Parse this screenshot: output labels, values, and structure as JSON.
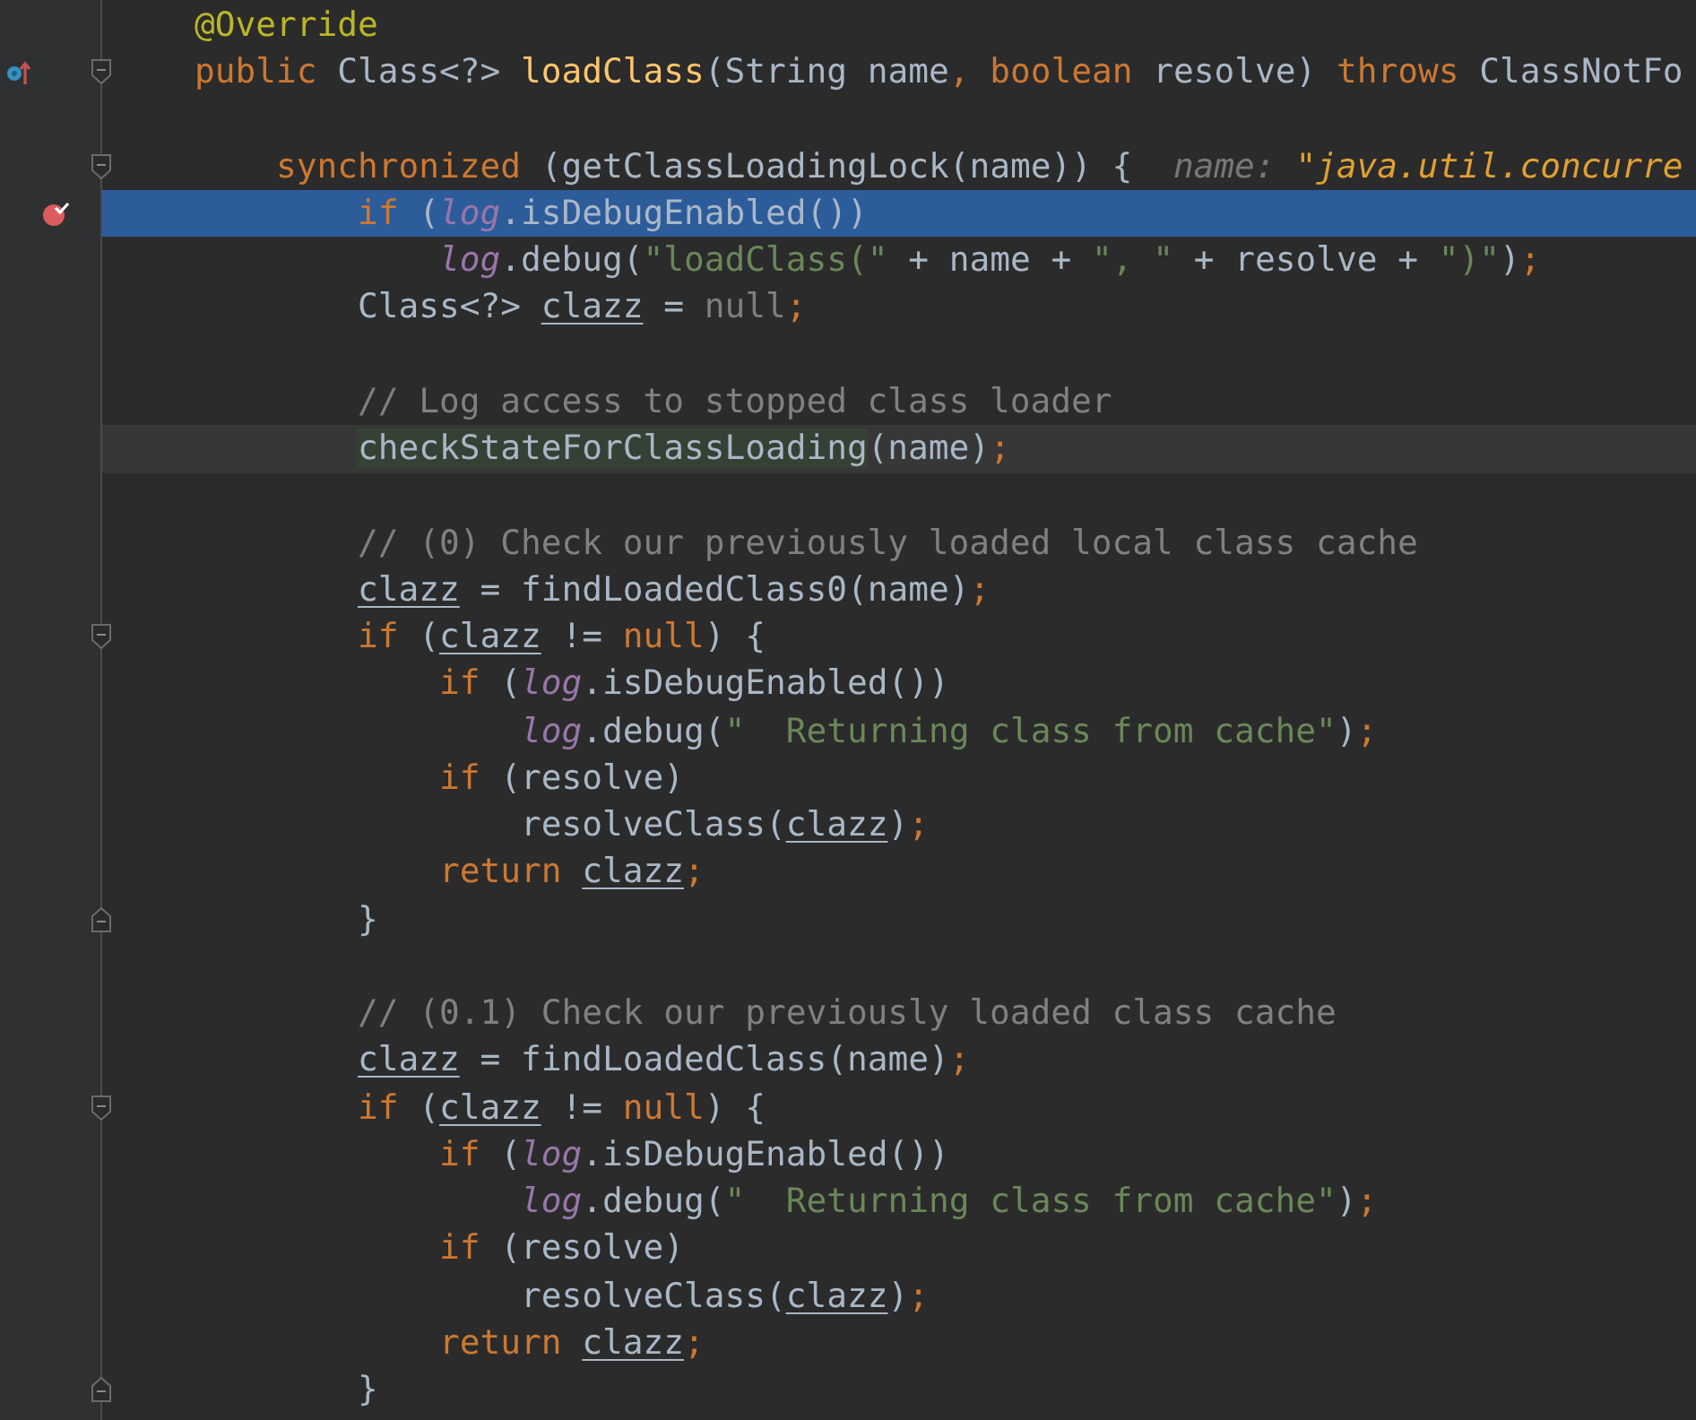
{
  "editor": {
    "lines": [
      {
        "execution_point": false,
        "caret_line": false,
        "breakpoint": false,
        "override_marker": false,
        "fold_start": false,
        "fold_end": false,
        "tokens": [
          {
            "kind": "annotation",
            "text": "    @Override"
          }
        ]
      },
      {
        "execution_point": false,
        "caret_line": false,
        "breakpoint": false,
        "override_marker": true,
        "fold_start": true,
        "fold_end": false,
        "tokens": [
          {
            "kind": "keyword",
            "text": "    public"
          },
          {
            "kind": "plain",
            "text": " Class<?> "
          },
          {
            "kind": "method",
            "text": "loadClass"
          },
          {
            "kind": "plain",
            "text": "(String name"
          },
          {
            "kind": "keyword",
            "text": ", boolean"
          },
          {
            "kind": "plain",
            "text": " resolve) "
          },
          {
            "kind": "keyword",
            "text": "throws"
          },
          {
            "kind": "plain",
            "text": " ClassNotFo"
          }
        ]
      },
      {
        "execution_point": false,
        "caret_line": false,
        "breakpoint": false,
        "override_marker": false,
        "fold_start": false,
        "fold_end": false
      },
      {
        "execution_point": false,
        "caret_line": false,
        "breakpoint": false,
        "override_marker": false,
        "fold_start": true,
        "fold_end": false,
        "tokens": [
          {
            "kind": "keyword",
            "text": "        synchronized"
          },
          {
            "kind": "plain",
            "text": " (getClassLoadingLock(name)) {  "
          },
          {
            "kind": "hint-label",
            "text": "name: "
          },
          {
            "kind": "hint-value",
            "text": "\"java.util.concurre"
          }
        ]
      },
      {
        "execution_point": true,
        "caret_line": false,
        "breakpoint": true,
        "override_marker": false,
        "fold_start": false,
        "fold_end": false,
        "tokens": [
          {
            "kind": "keyword",
            "text": "            if"
          },
          {
            "kind": "plain",
            "text": " ("
          },
          {
            "kind": "field",
            "text": "log"
          },
          {
            "kind": "plain",
            "text": ".isDebugEnabled())"
          }
        ]
      },
      {
        "execution_point": false,
        "caret_line": false,
        "breakpoint": false,
        "override_marker": false,
        "fold_start": false,
        "fold_end": false,
        "tokens": [
          {
            "kind": "field",
            "text": "                log"
          },
          {
            "kind": "plain",
            "text": ".debug("
          },
          {
            "kind": "string",
            "text": "\"loadClass(\""
          },
          {
            "kind": "plain",
            "text": " + name + "
          },
          {
            "kind": "string",
            "text": "\", \""
          },
          {
            "kind": "plain",
            "text": " + resolve + "
          },
          {
            "kind": "string",
            "text": "\")\""
          },
          {
            "kind": "plain",
            "text": ")"
          },
          {
            "kind": "keyword",
            "text": ";"
          }
        ]
      },
      {
        "execution_point": false,
        "caret_line": false,
        "breakpoint": false,
        "override_marker": false,
        "fold_start": false,
        "fold_end": false,
        "tokens": [
          {
            "kind": "plain",
            "text": "            Class<?> "
          },
          {
            "kind": "reassigned",
            "text": "clazz"
          },
          {
            "kind": "plain",
            "text": " = "
          },
          {
            "kind": "unused",
            "text": "null"
          },
          {
            "kind": "keyword",
            "text": ";"
          }
        ]
      },
      {
        "execution_point": false,
        "caret_line": false,
        "breakpoint": false,
        "override_marker": false,
        "fold_start": false,
        "fold_end": false
      },
      {
        "execution_point": false,
        "caret_line": false,
        "breakpoint": false,
        "override_marker": false,
        "fold_start": false,
        "fold_end": false,
        "tokens": [
          {
            "kind": "comment",
            "text": "            // Log access to stopped class loader"
          }
        ]
      },
      {
        "execution_point": false,
        "caret_line": true,
        "breakpoint": false,
        "override_marker": false,
        "fold_start": false,
        "fold_end": false,
        "tokens": [
          {
            "kind": "usage",
            "text": "            checkStateForClassLoading"
          },
          {
            "kind": "plain",
            "text": "(name)"
          },
          {
            "kind": "keyword",
            "text": ";"
          }
        ]
      },
      {
        "execution_point": false,
        "caret_line": false,
        "breakpoint": false,
        "override_marker": false,
        "fold_start": false,
        "fold_end": false
      },
      {
        "execution_point": false,
        "caret_line": false,
        "breakpoint": false,
        "override_marker": false,
        "fold_start": false,
        "fold_end": false,
        "tokens": [
          {
            "kind": "comment",
            "text": "            // (0) Check our previously loaded local class cache"
          }
        ]
      },
      {
        "execution_point": false,
        "caret_line": false,
        "breakpoint": false,
        "override_marker": false,
        "fold_start": false,
        "fold_end": false,
        "tokens": [
          {
            "kind": "reassigned",
            "text": "            clazz"
          },
          {
            "kind": "plain",
            "text": " = findLoadedClass0(name)"
          },
          {
            "kind": "keyword",
            "text": ";"
          }
        ]
      },
      {
        "execution_point": false,
        "caret_line": false,
        "breakpoint": false,
        "override_marker": false,
        "fold_start": true,
        "fold_end": false,
        "tokens": [
          {
            "kind": "keyword",
            "text": "            if"
          },
          {
            "kind": "plain",
            "text": " ("
          },
          {
            "kind": "reassigned",
            "text": "clazz"
          },
          {
            "kind": "plain",
            "text": " != "
          },
          {
            "kind": "keyword",
            "text": "null"
          },
          {
            "kind": "plain",
            "text": ") {"
          }
        ]
      },
      {
        "execution_point": false,
        "caret_line": false,
        "breakpoint": false,
        "override_marker": false,
        "fold_start": false,
        "fold_end": false,
        "tokens": [
          {
            "kind": "keyword",
            "text": "                if"
          },
          {
            "kind": "plain",
            "text": " ("
          },
          {
            "kind": "field",
            "text": "log"
          },
          {
            "kind": "plain",
            "text": ".isDebugEnabled())"
          }
        ]
      },
      {
        "execution_point": false,
        "caret_line": false,
        "breakpoint": false,
        "override_marker": false,
        "fold_start": false,
        "fold_end": false,
        "tokens": [
          {
            "kind": "field",
            "text": "                    log"
          },
          {
            "kind": "plain",
            "text": ".debug("
          },
          {
            "kind": "string",
            "text": "\"  Returning class from cache\""
          },
          {
            "kind": "plain",
            "text": ")"
          },
          {
            "kind": "keyword",
            "text": ";"
          }
        ]
      },
      {
        "execution_point": false,
        "caret_line": false,
        "breakpoint": false,
        "override_marker": false,
        "fold_start": false,
        "fold_end": false,
        "tokens": [
          {
            "kind": "keyword",
            "text": "                if"
          },
          {
            "kind": "plain",
            "text": " (resolve)"
          }
        ]
      },
      {
        "execution_point": false,
        "caret_line": false,
        "breakpoint": false,
        "override_marker": false,
        "fold_start": false,
        "fold_end": false,
        "tokens": [
          {
            "kind": "plain",
            "text": "                    resolveClass("
          },
          {
            "kind": "reassigned",
            "text": "clazz"
          },
          {
            "kind": "plain",
            "text": ")"
          },
          {
            "kind": "keyword",
            "text": ";"
          }
        ]
      },
      {
        "execution_point": false,
        "caret_line": false,
        "breakpoint": false,
        "override_marker": false,
        "fold_start": false,
        "fold_end": false,
        "tokens": [
          {
            "kind": "keyword",
            "text": "                return "
          },
          {
            "kind": "reassigned",
            "text": "clazz"
          },
          {
            "kind": "keyword",
            "text": ";"
          }
        ]
      },
      {
        "execution_point": false,
        "caret_line": false,
        "breakpoint": false,
        "override_marker": false,
        "fold_start": false,
        "fold_end": true,
        "tokens": [
          {
            "kind": "plain",
            "text": "            }"
          }
        ]
      },
      {
        "execution_point": false,
        "caret_line": false,
        "breakpoint": false,
        "override_marker": false,
        "fold_start": false,
        "fold_end": false
      },
      {
        "execution_point": false,
        "caret_line": false,
        "breakpoint": false,
        "override_marker": false,
        "fold_start": false,
        "fold_end": false,
        "tokens": [
          {
            "kind": "comment",
            "text": "            // (0.1) Check our previously loaded class cache"
          }
        ]
      },
      {
        "execution_point": false,
        "caret_line": false,
        "breakpoint": false,
        "override_marker": false,
        "fold_start": false,
        "fold_end": false,
        "tokens": [
          {
            "kind": "reassigned",
            "text": "            clazz"
          },
          {
            "kind": "plain",
            "text": " = findLoadedClass(name)"
          },
          {
            "kind": "keyword",
            "text": ";"
          }
        ]
      },
      {
        "execution_point": false,
        "caret_line": false,
        "breakpoint": false,
        "override_marker": false,
        "fold_start": true,
        "fold_end": false,
        "tokens": [
          {
            "kind": "keyword",
            "text": "            if"
          },
          {
            "kind": "plain",
            "text": " ("
          },
          {
            "kind": "reassigned",
            "text": "clazz"
          },
          {
            "kind": "plain",
            "text": " != "
          },
          {
            "kind": "keyword",
            "text": "null"
          },
          {
            "kind": "plain",
            "text": ") {"
          }
        ]
      },
      {
        "execution_point": false,
        "caret_line": false,
        "breakpoint": false,
        "override_marker": false,
        "fold_start": false,
        "fold_end": false,
        "tokens": [
          {
            "kind": "keyword",
            "text": "                if"
          },
          {
            "kind": "plain",
            "text": " ("
          },
          {
            "kind": "field",
            "text": "log"
          },
          {
            "kind": "plain",
            "text": ".isDebugEnabled())"
          }
        ]
      },
      {
        "execution_point": false,
        "caret_line": false,
        "breakpoint": false,
        "override_marker": false,
        "fold_start": false,
        "fold_end": false,
        "tokens": [
          {
            "kind": "field",
            "text": "                    log"
          },
          {
            "kind": "plain",
            "text": ".debug("
          },
          {
            "kind": "string",
            "text": "\"  Returning class from cache\""
          },
          {
            "kind": "plain",
            "text": ")"
          },
          {
            "kind": "keyword",
            "text": ";"
          }
        ]
      },
      {
        "execution_point": false,
        "caret_line": false,
        "breakpoint": false,
        "override_marker": false,
        "fold_start": false,
        "fold_end": false,
        "tokens": [
          {
            "kind": "keyword",
            "text": "                if"
          },
          {
            "kind": "plain",
            "text": " (resolve)"
          }
        ]
      },
      {
        "execution_point": false,
        "caret_line": false,
        "breakpoint": false,
        "override_marker": false,
        "fold_start": false,
        "fold_end": false,
        "tokens": [
          {
            "kind": "plain",
            "text": "                    resolveClass("
          },
          {
            "kind": "reassigned",
            "text": "clazz"
          },
          {
            "kind": "plain",
            "text": ")"
          },
          {
            "kind": "keyword",
            "text": ";"
          }
        ]
      },
      {
        "execution_point": false,
        "caret_line": false,
        "breakpoint": false,
        "override_marker": false,
        "fold_start": false,
        "fold_end": false,
        "tokens": [
          {
            "kind": "keyword",
            "text": "                return "
          },
          {
            "kind": "reassigned",
            "text": "clazz"
          },
          {
            "kind": "keyword",
            "text": ";"
          }
        ]
      },
      {
        "execution_point": false,
        "caret_line": false,
        "breakpoint": false,
        "override_marker": false,
        "fold_start": false,
        "fold_end": true,
        "tokens": [
          {
            "kind": "plain",
            "text": "            }"
          }
        ]
      }
    ]
  }
}
